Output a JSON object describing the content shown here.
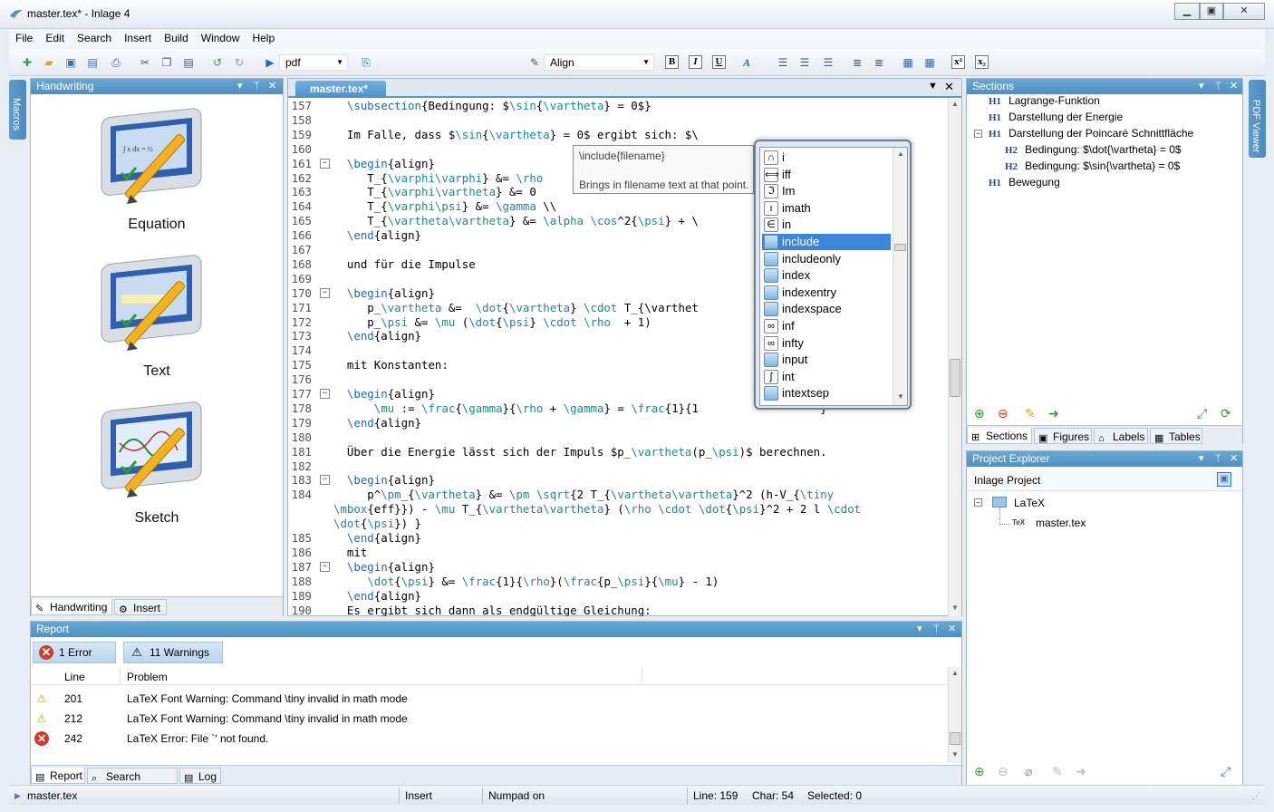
{
  "window": {
    "title": "master.tex* - Inlage 4"
  },
  "menu": [
    "File",
    "Edit",
    "Search",
    "Insert",
    "Build",
    "Window",
    "Help"
  ],
  "toolbar": {
    "output_format": "pdf",
    "environment": "Align"
  },
  "side_tabs": {
    "macros": "Macros",
    "pdf_viewer": "PDF Viewer"
  },
  "handwriting": {
    "title": "Handwriting",
    "items": [
      "Equation",
      "Text",
      "Sketch"
    ],
    "tabs": [
      "Handwriting",
      "Insert"
    ]
  },
  "editor": {
    "tab": "master.tex*",
    "lines": [
      {
        "n": "157",
        "code": "  \\subsection{Bedingung: $\\sin{\\vartheta} = 0$}"
      },
      {
        "n": "158",
        "code": ""
      },
      {
        "n": "159",
        "code": "  Im Falle, dass $\\sin{\\vartheta} = 0$ ergibt sich: $\\"
      },
      {
        "n": "160",
        "code": ""
      },
      {
        "n": "161",
        "code": "  \\begin{align}"
      },
      {
        "n": "162",
        "code": "     T_{\\varphi\\varphi} &= \\rho"
      },
      {
        "n": "163",
        "code": "     T_{\\varphi\\vartheta} &= 0"
      },
      {
        "n": "164",
        "code": "     T_{\\varphi\\psi} &= \\gamma \\\\"
      },
      {
        "n": "165",
        "code": "     T_{\\vartheta\\vartheta} &= \\alpha \\cos^2{\\psi} + \\"
      },
      {
        "n": "166",
        "code": "  \\end{align}"
      },
      {
        "n": "167",
        "code": ""
      },
      {
        "n": "168",
        "code": "  und für die Impulse"
      },
      {
        "n": "169",
        "code": ""
      },
      {
        "n": "170",
        "code": "  \\begin{align}"
      },
      {
        "n": "171",
        "code": "     p_\\vartheta &=  \\dot{\\vartheta} \\cdot T_{\\varthet"
      },
      {
        "n": "172",
        "code": "     p_\\psi &= \\mu (\\dot{\\psi} \\cdot \\rho  + 1)"
      },
      {
        "n": "173",
        "code": "  \\end{align}"
      },
      {
        "n": "174",
        "code": ""
      },
      {
        "n": "175",
        "code": "  mit Konstanten:"
      },
      {
        "n": "176",
        "code": ""
      },
      {
        "n": "177",
        "code": "  \\begin{align}"
      },
      {
        "n": "178",
        "code": "      \\mu := \\frac{\\gamma}{\\rho + \\gamma} = \\frac{1}{1                  }"
      },
      {
        "n": "179",
        "code": "  \\end{align}"
      },
      {
        "n": "180",
        "code": ""
      },
      {
        "n": "181",
        "code": "  Über die Energie lässt sich der Impuls $p_\\vartheta(p_\\psi)$ berechnen."
      },
      {
        "n": "182",
        "code": ""
      },
      {
        "n": "183",
        "code": "  \\begin{align}"
      },
      {
        "n": "184",
        "code": "     p^\\pm_{\\vartheta} &= \\pm \\sqrt{2 T_{\\vartheta\\vartheta}^2 (h-V_{\\tiny"
      },
      {
        "n": "",
        "code": "\\mbox{eff}}) - \\mu T_{\\vartheta\\vartheta} (\\rho \\cdot \\dot{\\psi}^2 + 2 l \\cdot"
      },
      {
        "n": "",
        "code": "\\dot{\\psi}) }"
      },
      {
        "n": "185",
        "code": "  \\end{align}"
      },
      {
        "n": "186",
        "code": "  mit"
      },
      {
        "n": "187",
        "code": "  \\begin{align}"
      },
      {
        "n": "188",
        "code": "     \\dot{\\psi} &= \\frac{1}{\\rho}(\\frac{p_\\psi}{\\mu} - 1)"
      },
      {
        "n": "189",
        "code": "  \\end{align}"
      },
      {
        "n": "190",
        "code": "  Es ergibt sich dann als endgültige Gleichung:"
      }
    ]
  },
  "tooltip": {
    "signature": "\\include{filename}",
    "description": "Brings in filename text at that point."
  },
  "autocomplete": {
    "items": [
      "i",
      "iff",
      "Im",
      "imath",
      "in",
      "include",
      "includeonly",
      "index",
      "indexentry",
      "indexspace",
      "inf",
      "infty",
      "input",
      "int",
      "intextsep"
    ],
    "icons": [
      "∩",
      "⟺",
      "ℑ",
      "ı",
      "∈",
      "",
      "",
      "",
      "",
      "",
      "∞",
      "∞",
      "",
      "∫",
      ""
    ],
    "selected": "include"
  },
  "sections": {
    "title": "Sections",
    "items": [
      {
        "level": "H1",
        "text": "Lagrange-Funktion"
      },
      {
        "level": "H1",
        "text": "Darstellung der Energie"
      },
      {
        "level": "H1",
        "text": "Darstellung der Poincaré Schnittfläche"
      },
      {
        "level": "H2",
        "text": "Bedingung: $\\dot{\\vartheta} = 0$"
      },
      {
        "level": "H2",
        "text": "Bedingung: $\\sin{\\vartheta} = 0$"
      },
      {
        "level": "H1",
        "text": "Bewegung"
      }
    ],
    "tabs": [
      "Sections",
      "Figures",
      "Labels",
      "Tables"
    ]
  },
  "project_explorer": {
    "title": "Project Explorer",
    "project": "Inlage Project",
    "folder": "LaTeX",
    "file_badge": "TeX",
    "file": "master.tex"
  },
  "report": {
    "title": "Report",
    "errors": "1 Error",
    "warnings": "11 Warnings",
    "columns": [
      "Line",
      "Problem"
    ],
    "rows": [
      {
        "type": "warning",
        "line": "201",
        "problem": "LaTeX Font Warning: Command \\tiny invalid in math mode"
      },
      {
        "type": "warning",
        "line": "212",
        "problem": "LaTeX Font Warning: Command \\tiny invalid in math mode"
      },
      {
        "type": "error",
        "line": "242",
        "problem": "LaTeX Error: File `' not found."
      }
    ],
    "tabs": [
      "Report",
      "Search Results",
      "Log"
    ]
  },
  "status": {
    "file": "master.tex",
    "mode": "Insert",
    "numpad": "Numpad on",
    "line": "Line: 159",
    "char": "Char: 54",
    "selected": "Selected: 0"
  },
  "colors": {
    "accent": "#4e90c2",
    "selection": "#3a86d9",
    "keyword": "#2267b8"
  }
}
